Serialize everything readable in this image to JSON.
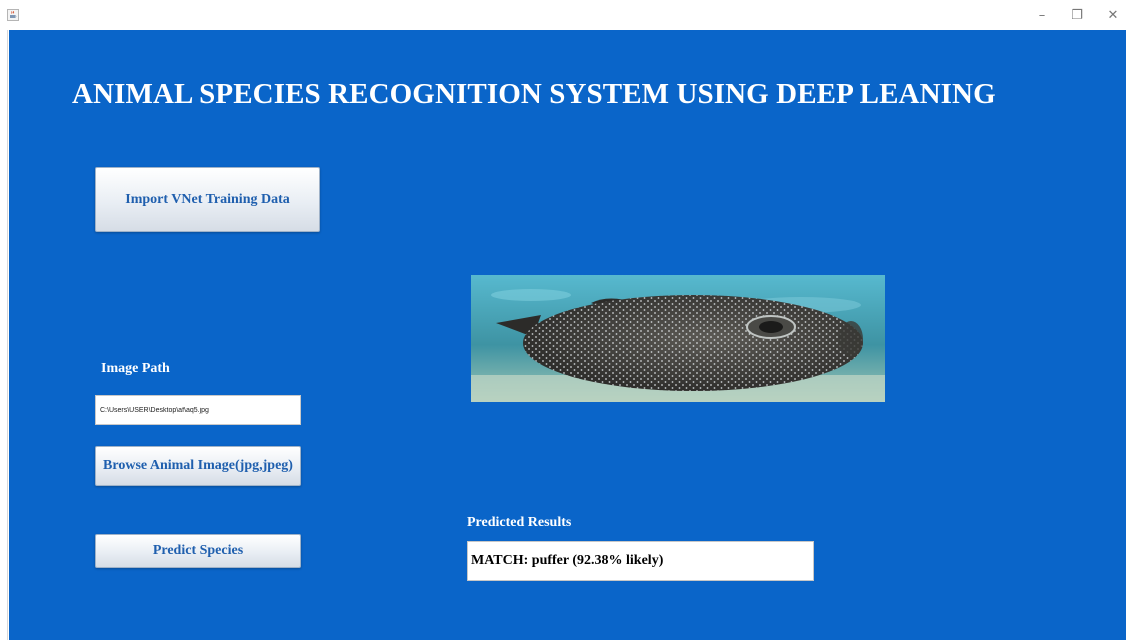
{
  "window": {
    "icons": {
      "app": "java-cup-icon",
      "minimize": "minimize-icon",
      "restore": "restore-icon",
      "close": "close-icon"
    },
    "minimize_glyph": "–",
    "restore_glyph": "❐",
    "close_glyph": "✕"
  },
  "header": {
    "title": "ANIMAL SPECIES RECOGNITION SYSTEM USING DEEP LEANING"
  },
  "controls": {
    "import_button": "Import VNet Training Data",
    "image_path_label": "Image Path",
    "image_path_value": "C:\\Users\\USER\\Desktop\\af\\aq5.jpg",
    "browse_button": "Browse Animal Image(jpg,jpeg)",
    "predict_button": "Predict Species"
  },
  "results": {
    "label": "Predicted Results",
    "value": "MATCH: puffer (92.38% likely)"
  },
  "image_preview": {
    "subject": "puffer-fish"
  },
  "colors": {
    "background": "#0a65c9",
    "button_text": "#1f5fae",
    "label_text": "#ffffff"
  }
}
